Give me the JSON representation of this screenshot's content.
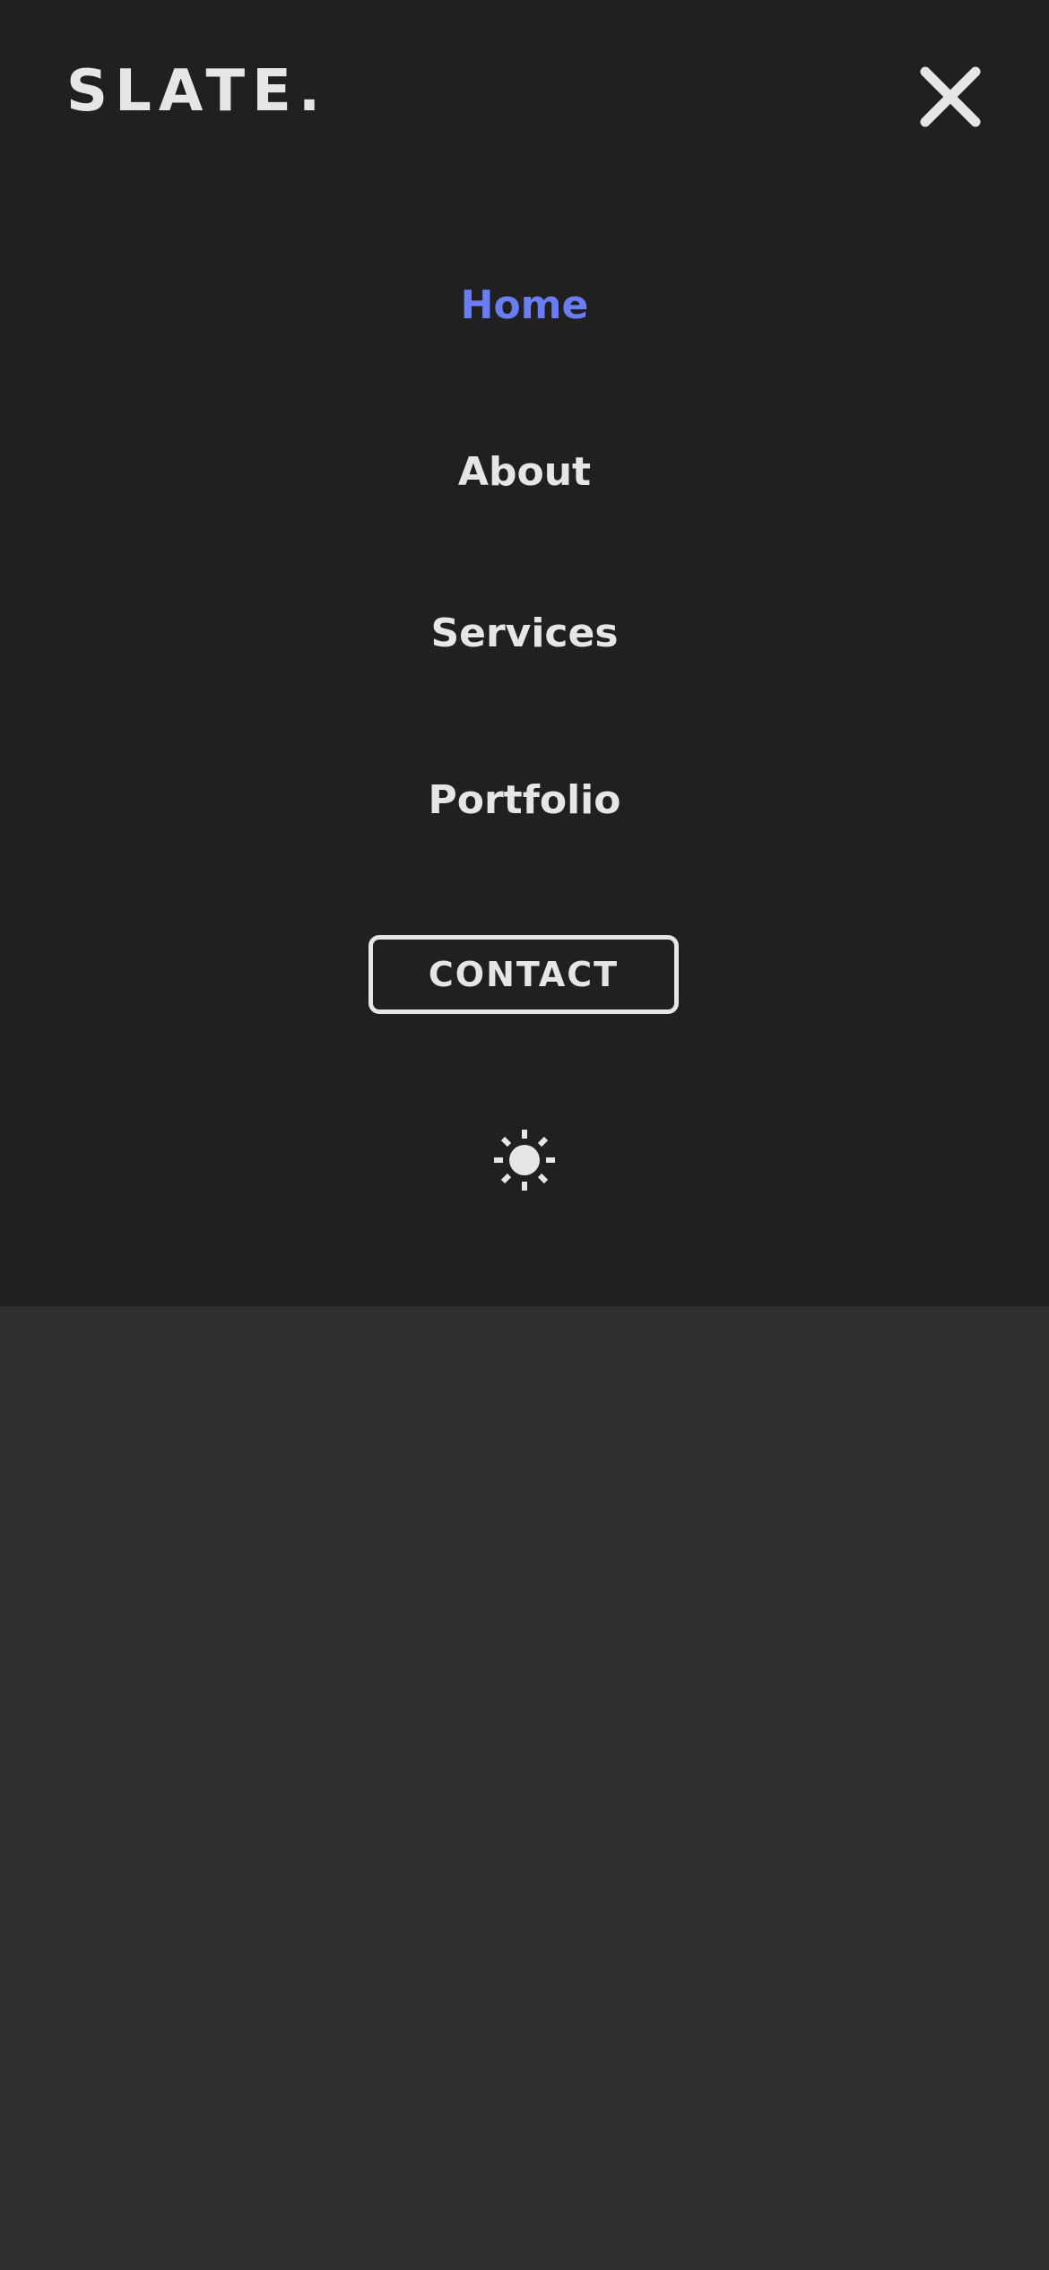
{
  "header": {
    "logo_text": "SLATE.",
    "close_icon": "close-icon"
  },
  "nav": {
    "items": [
      {
        "label": "Home",
        "active": true
      },
      {
        "label": "About",
        "active": false
      },
      {
        "label": "Services",
        "active": false
      },
      {
        "label": "Portfolio",
        "active": false
      }
    ],
    "contact_label": "CONTACT",
    "theme_icon": "sun-icon"
  },
  "colors": {
    "menu_background": "#202020",
    "page_background": "#2f2f2f",
    "text": "#e6e6e6",
    "accent": "#6a7df2"
  }
}
